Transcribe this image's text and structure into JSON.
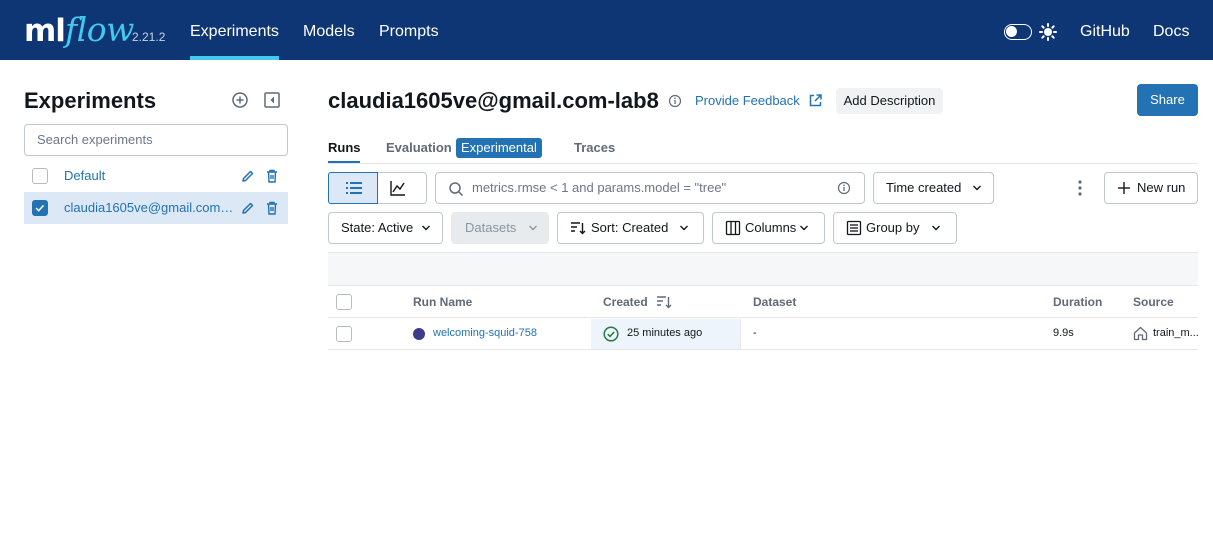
{
  "nav": {
    "logo_ml": "ml",
    "logo_flow": "flow",
    "version": "2.21.2",
    "items": [
      {
        "label": "Experiments"
      },
      {
        "label": "Models"
      },
      {
        "label": "Prompts"
      }
    ],
    "github": "GitHub",
    "docs": "Docs",
    "accent": "#43c9ed",
    "background": "#0e3675"
  },
  "sidebar": {
    "title": "Experiments",
    "search_placeholder": "Search experiments",
    "experiments": [
      {
        "label": "Default",
        "checked": false
      },
      {
        "label": "claudia1605ve@gmail.com-lab8",
        "checked": true
      }
    ]
  },
  "header": {
    "title": "claudia1605ve@gmail.com-lab8",
    "feedback": "Provide Feedback",
    "add_description": "Add Description",
    "share": "Share"
  },
  "tabs": {
    "runs": "Runs",
    "evaluation": "Evaluation",
    "experimental_badge": "Experimental",
    "traces": "Traces"
  },
  "toolbar": {
    "search_placeholder": "metrics.rmse < 1 and params.model = \"tree\"",
    "time_created": "Time created",
    "new_run": "New run",
    "state": "State: Active",
    "datasets": "Datasets",
    "sort": "Sort: Created",
    "columns": "Columns",
    "group_by": "Group by"
  },
  "table": {
    "headers": {
      "run_name": "Run Name",
      "created": "Created",
      "dataset": "Dataset",
      "duration": "Duration",
      "source": "Source"
    },
    "rows": [
      {
        "run_name": "welcoming-squid-758",
        "created": "25 minutes ago",
        "dataset": "-",
        "duration": "9.9s",
        "source": "train_m..."
      }
    ]
  },
  "colors": {
    "primary": "#2272b4",
    "run_dot": "#3e3b8a",
    "success": "#277c43"
  }
}
